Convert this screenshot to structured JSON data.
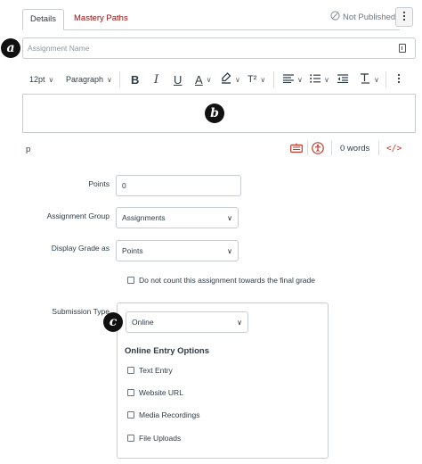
{
  "tabs": [
    {
      "label": "Details",
      "active": true
    },
    {
      "label": "Mastery Paths",
      "active": false
    }
  ],
  "publish_status": "Not Published",
  "assignment_name": {
    "value": "",
    "placeholder": "Assignment Name"
  },
  "toolbar": {
    "font_size": "12pt",
    "block_format": "Paragraph",
    "bold": "B",
    "italic": "I",
    "underline": "U",
    "text_color": "A",
    "superscript": "T²"
  },
  "status_bar": {
    "path": "p",
    "word_count": "0 words",
    "html_toggle": "</>"
  },
  "badges": {
    "a": "a",
    "b": "b",
    "c": "c"
  },
  "form": {
    "points": {
      "label": "Points",
      "value": "0"
    },
    "assignment_group": {
      "label": "Assignment Group",
      "value": "Assignments"
    },
    "display_grade": {
      "label": "Display Grade as",
      "value": "Points"
    },
    "do_not_count": {
      "label": "Do not count this assignment towards the final grade",
      "checked": false
    },
    "submission_type": {
      "label": "Submission Type",
      "value": "Online"
    },
    "online_entry": {
      "heading": "Online Entry Options",
      "options": [
        {
          "label": "Text Entry",
          "checked": false
        },
        {
          "label": "Website URL",
          "checked": false
        },
        {
          "label": "Media Recordings",
          "checked": false
        },
        {
          "label": "File Uploads",
          "checked": false
        }
      ]
    }
  },
  "colors": {
    "mastery_tab": "#8b0e0e",
    "border": "#c7cdd1",
    "text": "#2d3b45",
    "accessibility_red": "#c0392b"
  }
}
